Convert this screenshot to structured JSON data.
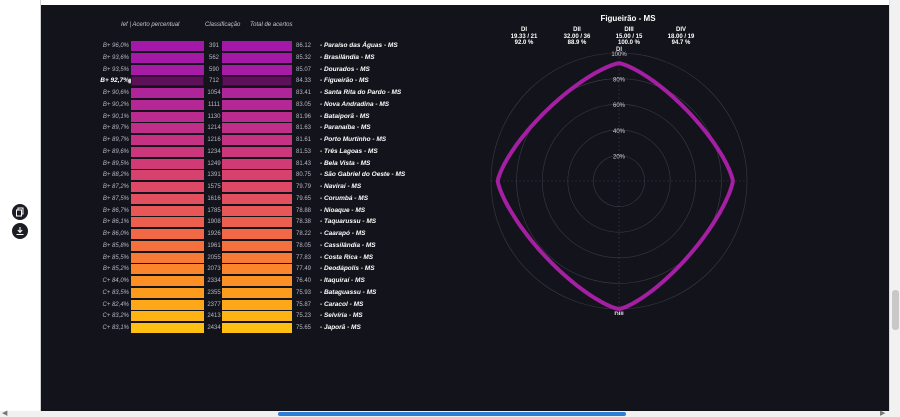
{
  "side_actions": [
    {
      "icon": "copy-icon"
    },
    {
      "icon": "download-icon"
    }
  ],
  "table": {
    "headers": [
      "Ief | Acerto percentual",
      "Classificação",
      "Total de acertos"
    ],
    "rows": [
      {
        "code": "B+ 96,0%",
        "rank": "391",
        "total": "86.12",
        "name": "- Paraíso das Águas - MS",
        "color": "#a318a8",
        "selected": false
      },
      {
        "code": "B+ 93,6%",
        "rank": "562",
        "total": "85.32",
        "name": "- Brasilândia - MS",
        "color": "#a41aa6",
        "selected": false
      },
      {
        "code": "B+ 93,5%",
        "rank": "590",
        "total": "85.07",
        "name": "- Dourados - MS",
        "color": "#a61ca4",
        "selected": false
      },
      {
        "code": "B+ 92,7%",
        "rank": "712",
        "total": "84.33",
        "name": "- Figueirão - MS",
        "color": "#a91fa2",
        "selected": true
      },
      {
        "code": "B+ 90,6%",
        "rank": "1054",
        "total": "83.41",
        "name": "- Santa Rita do Pardo - MS",
        "color": "#b0249a",
        "selected": false
      },
      {
        "code": "B+ 90,2%",
        "rank": "1111",
        "total": "83.05",
        "name": "- Nova Andradina - MS",
        "color": "#b52795",
        "selected": false
      },
      {
        "code": "B+ 90,1%",
        "rank": "1130",
        "total": "81.96",
        "name": "- Bataiporã - MS",
        "color": "#ba2a8f",
        "selected": false
      },
      {
        "code": "B+ 89,7%",
        "rank": "1214",
        "total": "81.63",
        "name": "- Paranaíba - MS",
        "color": "#c02e89",
        "selected": false
      },
      {
        "code": "B+ 89,7%",
        "rank": "1216",
        "total": "81.61",
        "name": "- Porto Murtinho - MS",
        "color": "#c53283",
        "selected": false
      },
      {
        "code": "B+ 89,6%",
        "rank": "1234",
        "total": "81.53",
        "name": "- Três Lagoas - MS",
        "color": "#cb367c",
        "selected": false
      },
      {
        "code": "B+ 89,5%",
        "rank": "1249",
        "total": "81.43",
        "name": "- Bela Vista - MS",
        "color": "#d03b75",
        "selected": false
      },
      {
        "code": "B+ 88,2%",
        "rank": "1391",
        "total": "80.75",
        "name": "- São Gabriel do Oeste - MS",
        "color": "#d6416d",
        "selected": false
      },
      {
        "code": "B+ 87,2%",
        "rank": "1575",
        "total": "79.79",
        "name": "- Naviraí - MS",
        "color": "#dc4866",
        "selected": false
      },
      {
        "code": "B+ 87,5%",
        "rank": "1616",
        "total": "79.65",
        "name": "- Corumbá - MS",
        "color": "#e24f5e",
        "selected": false
      },
      {
        "code": "B+ 86,7%",
        "rank": "1785",
        "total": "78.88",
        "name": "- Nioaque - MS",
        "color": "#e75756",
        "selected": false
      },
      {
        "code": "B+ 86,1%",
        "rank": "1908",
        "total": "78.38",
        "name": "- Taquarussu - MS",
        "color": "#ec5f4e",
        "selected": false
      },
      {
        "code": "B+ 86,0%",
        "rank": "1926",
        "total": "78.22",
        "name": "- Caarapó - MS",
        "color": "#f06846",
        "selected": false
      },
      {
        "code": "B+ 85,8%",
        "rank": "1961",
        "total": "78.05",
        "name": "- Cassilândia - MS",
        "color": "#f4713e",
        "selected": false
      },
      {
        "code": "B+ 85,5%",
        "rank": "2055",
        "total": "77.83",
        "name": "- Costa Rica - MS",
        "color": "#f77b35",
        "selected": false
      },
      {
        "code": "B+ 85,2%",
        "rank": "2073",
        "total": "77.49",
        "name": "- Deodápolis - MS",
        "color": "#fa852d",
        "selected": false
      },
      {
        "code": "C+ 84,0%",
        "rank": "2334",
        "total": "76.40",
        "name": "- Itaquiraí - MS",
        "color": "#fc9025",
        "selected": false
      },
      {
        "code": "C+ 83,5%",
        "rank": "2355",
        "total": "75.93",
        "name": "- Bataguassu - MS",
        "color": "#fd9b1e",
        "selected": false
      },
      {
        "code": "C+ 82,4%",
        "rank": "2377",
        "total": "75.87",
        "name": "- Caracol - MS",
        "color": "#fea718",
        "selected": false
      },
      {
        "code": "C+ 83,2%",
        "rank": "2413",
        "total": "75.23",
        "name": "- Selvíria - MS",
        "color": "#feb314",
        "selected": false
      },
      {
        "code": "C+ 83,1%",
        "rank": "2434",
        "total": "75.65",
        "name": "- Japorã - MS",
        "color": "#fdbf12",
        "selected": false
      }
    ]
  },
  "radar": {
    "title": "Figueirão - MS",
    "stats": [
      {
        "label": "DI",
        "score": "19.33 / 21",
        "pct": "92.0 %"
      },
      {
        "label": "DII",
        "score": "32.00 / 36",
        "pct": "88.9 %"
      },
      {
        "label": "DIII",
        "score": "15.00 / 15",
        "pct": "100.0 %"
      },
      {
        "label": "DIV",
        "score": "18.00 / 19",
        "pct": "94.7 %"
      }
    ],
    "axis_labels": {
      "top": "DI",
      "right": "DII",
      "bottom": "DIII",
      "left": "DIV"
    },
    "ring_labels": [
      "20%",
      "40%",
      "60%",
      "80%",
      "100%"
    ],
    "accent_color": "#a41fa2"
  },
  "chart_data": {
    "type": "radar",
    "title": "Figueirão - MS",
    "categories": [
      "DI",
      "DII",
      "DIII",
      "DIV"
    ],
    "values": [
      92.0,
      88.9,
      100.0,
      94.7
    ],
    "ylim": [
      0,
      100
    ],
    "grid": true
  }
}
